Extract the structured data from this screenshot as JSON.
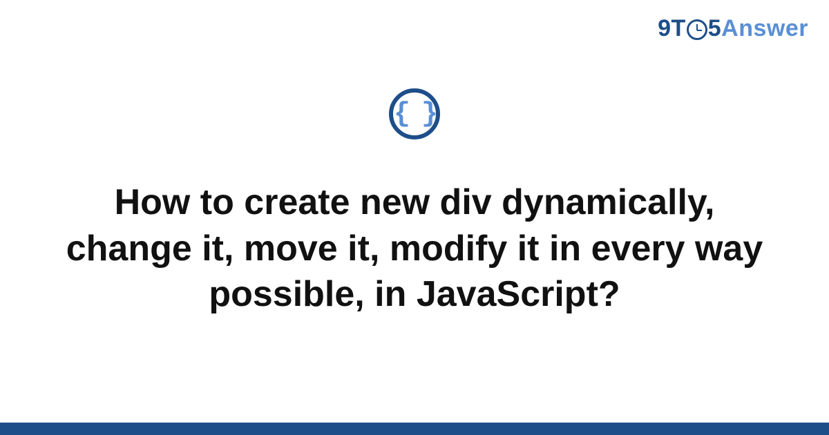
{
  "brand": {
    "part1": "9T",
    "part2": "5",
    "part3": "Answer"
  },
  "icon": {
    "name": "code-braces-icon",
    "glyph": "{ }"
  },
  "title": "How to create new div dynamically, change it, move it, modify it in every way possible, in JavaScript?",
  "colors": {
    "brand_dark": "#1d4e89",
    "brand_light": "#5a8fd6",
    "text": "#111111",
    "footer": "#1d4e89"
  }
}
